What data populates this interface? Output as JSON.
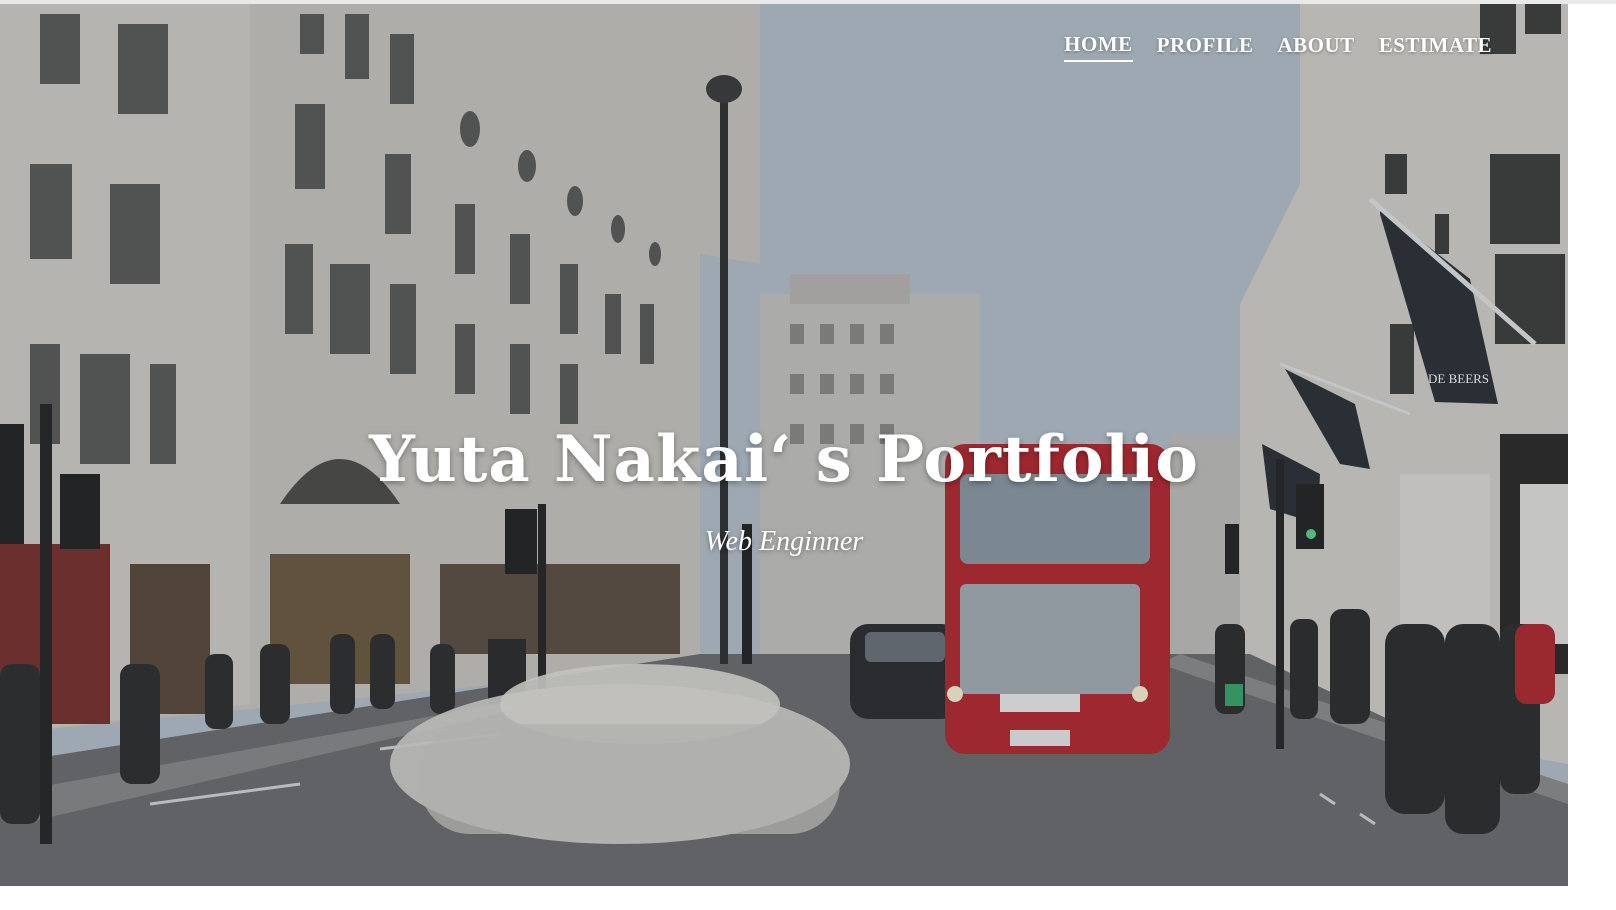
{
  "nav": {
    "items": [
      {
        "label": "HOME",
        "active": true
      },
      {
        "label": "PROFILE",
        "active": false
      },
      {
        "label": "ABOUT",
        "active": false
      },
      {
        "label": "ESTIMATE",
        "active": false
      }
    ]
  },
  "hero": {
    "title": "Yuta Nakai‘ s Portfolio",
    "subtitle": "Web Enginner",
    "background_description_icon": "street-photo",
    "store_sign": "DE BEERS"
  },
  "colors": {
    "text": "#ffffff",
    "sky": "#b7c2cc",
    "bus_red": "#c0282d"
  }
}
